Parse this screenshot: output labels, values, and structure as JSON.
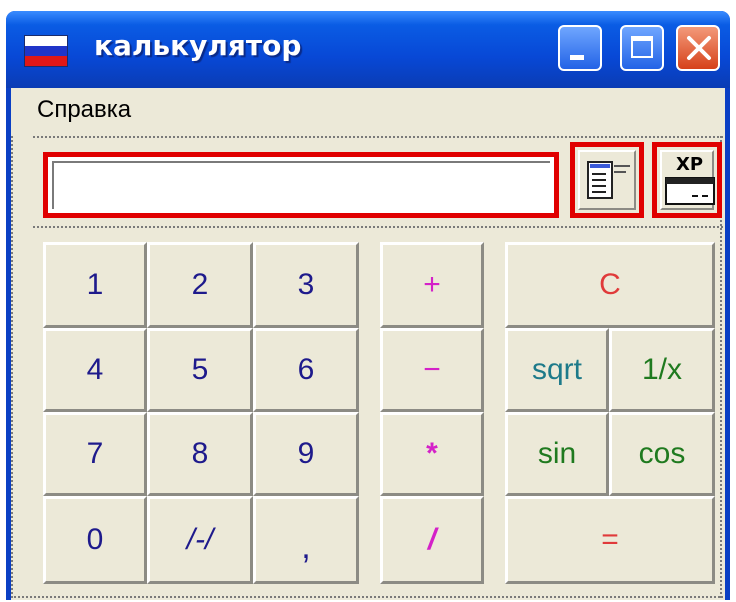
{
  "window": {
    "title": "калькулятор",
    "flag_colors": [
      "#ffffff",
      "#1f35c9",
      "#e01717"
    ]
  },
  "title_buttons": {
    "minimize": "minimize-icon",
    "maximize": "maximize-icon",
    "close": "close-icon"
  },
  "menu": {
    "help_label": "Справка"
  },
  "display": {
    "value": ""
  },
  "toolbar": {
    "mode_icon": "list-icon",
    "xp_icon": "xp-window-icon",
    "xp_label": "XP"
  },
  "keys": {
    "digits": [
      "1",
      "2",
      "3",
      "4",
      "5",
      "6",
      "7",
      "8",
      "9",
      "0"
    ],
    "negate": "/-/",
    "decimal": ",",
    "plus": "+",
    "minus": "−",
    "multiply": "*",
    "divide": "/",
    "clear": "C",
    "sqrt": "sqrt",
    "reciprocal": "1/x",
    "sin": "sin",
    "cos": "cos",
    "equals": "="
  },
  "colors": {
    "digit": "#1e1a8c",
    "operator": "#d421c8",
    "clear": "#e03a3a",
    "highlight_frame": "#e00000"
  }
}
